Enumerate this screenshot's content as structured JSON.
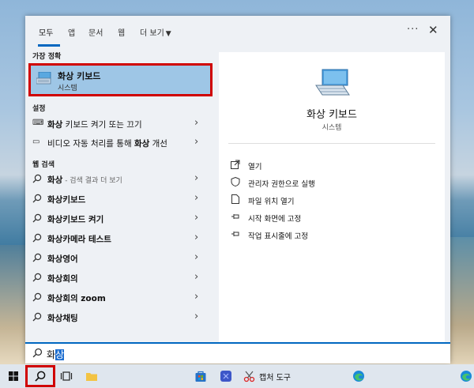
{
  "tabs": [
    {
      "label": "모두",
      "active": true
    },
    {
      "label": "앱",
      "active": false
    },
    {
      "label": "문서",
      "active": false
    },
    {
      "label": "웹",
      "active": false
    },
    {
      "label": "더 보기",
      "active": false
    }
  ],
  "header_controls": {
    "more": "···",
    "close": "✕"
  },
  "left": {
    "best_match_header": "가장 정확",
    "best_match": {
      "title": "화상 키보드",
      "subtitle": "시스템"
    },
    "settings_header": "설정",
    "settings": [
      {
        "pre": "",
        "bold": "화상",
        "post": " 키보드 켜기 또는 끄기"
      },
      {
        "pre": "비디오 자동 처리를 통해 ",
        "bold": "화상",
        "post": " 개선"
      }
    ],
    "web_header": "웹 검색",
    "web": [
      {
        "text": "화상",
        "hint": " - 검색 결과 더 보기"
      },
      {
        "text": "화상키보드",
        "hint": ""
      },
      {
        "text": "화상키보드 켜기",
        "hint": ""
      },
      {
        "text": "화상카메라 테스트",
        "hint": ""
      },
      {
        "text": "화상영어",
        "hint": ""
      },
      {
        "text": "화상회의",
        "hint": ""
      },
      {
        "text": "화상회의 zoom",
        "hint": ""
      },
      {
        "text": "화상채팅",
        "hint": ""
      }
    ]
  },
  "right": {
    "title": "화상 키보드",
    "subtitle": "시스템",
    "actions": [
      {
        "label": "열기",
        "icon": "open-icon"
      },
      {
        "label": "관리자 권한으로 실행",
        "icon": "shield-icon"
      },
      {
        "label": "파일 위치 열기",
        "icon": "file-location-icon"
      },
      {
        "label": "시작 화면에 고정",
        "icon": "pin-icon"
      },
      {
        "label": "작업 표시줄에 고정",
        "icon": "pin-icon"
      }
    ]
  },
  "search": {
    "typed": "화",
    "selected": "상"
  },
  "taskbar": {
    "capture_tool_label": "캡처 도구"
  },
  "colors": {
    "accent": "#0067c0",
    "highlight": "#9ec6e6",
    "annotation": "#d00000"
  }
}
